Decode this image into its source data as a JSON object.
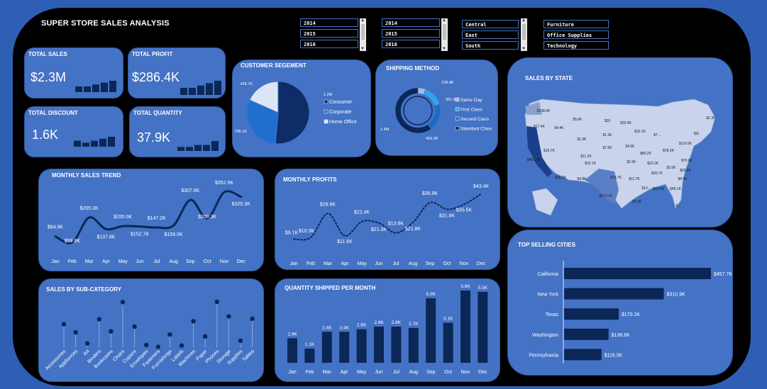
{
  "dashboard": {
    "title": "SUPER STORE SALES ANALYSIS"
  },
  "slicers": [
    {
      "items": [
        "2014",
        "2015",
        "2016"
      ]
    },
    {
      "items": [
        "2014",
        "2015",
        "2016"
      ]
    },
    {
      "items": [
        "Central",
        "East",
        "South"
      ]
    },
    {
      "items": [
        "Furniture",
        "Office Supplies",
        "Technology"
      ]
    }
  ],
  "kpis": {
    "total_sales": {
      "label": "TOTAL SALES",
      "value": "$2.3M"
    },
    "total_profit": {
      "label": "TOTAL PROFIT",
      "value": "$286.4K"
    },
    "total_discount": {
      "label": "TOTAL DISCOUNT",
      "value": "1.6K"
    },
    "total_quantity": {
      "label": "TOTAL QUANTITY",
      "value": "37.9K"
    }
  },
  "titles": {
    "segment": "CUSTOMER SEGEMENT",
    "shipping": "SHIPPING METHOD",
    "state": "SALES BY STATE",
    "trend": "MONTHLY SALES TREND",
    "profits": "MONTHLY  PROFITS",
    "subcat": "SALES BY SUB-CATEGORY",
    "qty": "QUANTITY SHIPPED PER MONTH",
    "cities": "TOP SELLING CITIES"
  },
  "chart_data": [
    {
      "id": "segment",
      "type": "pie",
      "title": "CUSTOMER SEGEMENT",
      "labels": [
        "Consumer",
        "Corporate",
        "Home Office"
      ],
      "values": [
        1.2,
        0.7061,
        0.4297
      ],
      "data_labels": [
        "1.2M",
        "706.1K",
        "429.7K"
      ],
      "colors": [
        "#0e2c66",
        "#1f6fcf",
        "#dce5f5"
      ],
      "legend": "right"
    },
    {
      "id": "shipping",
      "type": "pie",
      "title": "SHIPPING METHOD",
      "labels": [
        "Same Day",
        "First Class",
        "Second Class",
        "Standard Class"
      ],
      "values": [
        128.4,
        351.4,
        459.2,
        1400
      ],
      "data_labels": [
        "128.4K",
        "351.4K",
        "459.2K",
        "1.4M"
      ],
      "colors": [
        "#a9b9d8",
        "#2fa7e8",
        "#1b6bc2",
        "#0b2757"
      ],
      "legend": "right"
    },
    {
      "id": "state",
      "type": "map",
      "title": "SALES BY STATE",
      "labels": [
        "$138.6K",
        "$1.3K",
        "$5.6K",
        "$20",
        "$20.9K",
        "$17.4K",
        "$4.4K",
        "$1.3K",
        "$32.1K",
        "$3L",
        "$1.6K",
        "$7...",
        "$116.5K",
        "$16.7K",
        "$11.2K",
        "$7.5K",
        "$4.6K",
        "$80.2K",
        "$78.3K",
        "$457.7K",
        "$32.1K",
        "$2.9K",
        "$22.2K",
        "$70.6K",
        "$3.5K",
        "$30.7K",
        "$55.6K",
        "$35.3K",
        "$4.8K",
        "$19.7K",
        "$11.7K",
        "$8.5K",
        "$10..",
        "$10.5K",
        "$49.1K",
        "$170.2K",
        "$6.2K",
        "$..."
      ]
    },
    {
      "id": "trend",
      "type": "line",
      "title": "MONTHLY SALES TREND",
      "categories": [
        "Jan",
        "Feb",
        "Mar",
        "Apr",
        "May",
        "Jun",
        "Jul",
        "Aug",
        "Sep",
        "Oct",
        "Nov",
        "Dec"
      ],
      "values": [
        94.9,
        59.8,
        205.0,
        137.8,
        155.0,
        152.7,
        147.2,
        159.0,
        307.6,
        200.3,
        352.5,
        325.3
      ],
      "data_labels": [
        "$94.9K",
        "$59.8K",
        "$205.0K",
        "$137.8K",
        "$155.0K",
        "$152.7K",
        "$147.2K",
        "$159.0K",
        "$307.6K",
        "$200.3K",
        "$352.5K",
        "$325.3K"
      ],
      "color": "#0b2757"
    },
    {
      "id": "profits",
      "type": "line",
      "title": "MONTHLY  PROFITS",
      "categories": [
        "Jan",
        "Feb",
        "Mar",
        "Apr",
        "May",
        "Jun",
        "Jul",
        "Aug",
        "Sep",
        "Oct",
        "Nov",
        "Dec"
      ],
      "values": [
        9.1,
        10.3,
        28.6,
        11.6,
        22.4,
        21.3,
        13.8,
        21.8,
        36.9,
        31.8,
        35.5,
        43.4
      ],
      "data_labels": [
        "$9.1K",
        "$10.3K",
        "$28.6K",
        "$11.6K",
        "$22.4K",
        "$21.3K",
        "$13.8K",
        "$21.8K",
        "$36.9K",
        "$31.8K",
        "$35.5K",
        "$43.4K"
      ],
      "color": "#0b2757",
      "line_style": "dotted"
    },
    {
      "id": "subcat",
      "type": "scatter",
      "title": "SALES BY SUB-CATEGORY",
      "categories": [
        "Accessories",
        "Appliances",
        "Art",
        "Binders",
        "Bookcases",
        "Chairs",
        "Copiers",
        "Envelopes",
        "Fasteners",
        "Furnishings",
        "Labels",
        "Machines",
        "Paper",
        "Phones",
        "Storage",
        "Supplies",
        "Tables"
      ],
      "values": [
        167,
        108,
        27,
        203,
        115,
        328,
        150,
        16,
        3,
        92,
        12,
        189,
        78,
        330,
        224,
        47,
        207
      ],
      "color": "#0b2757"
    },
    {
      "id": "qty",
      "type": "bar",
      "title": "QUANTITY SHIPPED PER MONTH",
      "categories": [
        "Jan",
        "Feb",
        "Mar",
        "Apr",
        "May",
        "Jun",
        "Jul",
        "Aug",
        "Sep",
        "Oct",
        "Nov",
        "Dec"
      ],
      "values": [
        1.9,
        1.1,
        2.4,
        2.4,
        2.6,
        2.8,
        2.8,
        2.7,
        5.0,
        3.1,
        5.6,
        5.5
      ],
      "data_labels": [
        "1.9K",
        "1.1K",
        "2.4K",
        "2.4K",
        "2.6K",
        "2.8K",
        "2.8K",
        "2.7K",
        "5.0K",
        "3.1K",
        "5.6K",
        "5.5K"
      ],
      "color": "#0b2757"
    },
    {
      "id": "cities",
      "type": "bar",
      "orientation": "horizontal",
      "title": "TOP SELLING CITIES",
      "categories": [
        "California",
        "New York",
        "Texas",
        "Washington",
        "Pennsylvania"
      ],
      "values": [
        457.7,
        310.9,
        170.2,
        138.6,
        116.5
      ],
      "data_labels": [
        "$457.7K",
        "$310.9K",
        "$170.2K",
        "$138.6K",
        "$116.5K"
      ],
      "color": "#0b2757"
    },
    {
      "id": "spark_sales",
      "type": "bar",
      "values": [
        3,
        3,
        4,
        5,
        6
      ],
      "color": "#0b2757"
    },
    {
      "id": "spark_profit",
      "type": "bar",
      "values": [
        3,
        3,
        4,
        5,
        6
      ],
      "color": "#0b2757"
    },
    {
      "id": "spark_discount",
      "type": "bar",
      "values": [
        3,
        2,
        3,
        4,
        5
      ],
      "color": "#0b2757"
    },
    {
      "id": "spark_quantity",
      "type": "bar",
      "values": [
        2,
        2,
        3,
        3,
        5
      ],
      "color": "#0b2757"
    }
  ]
}
